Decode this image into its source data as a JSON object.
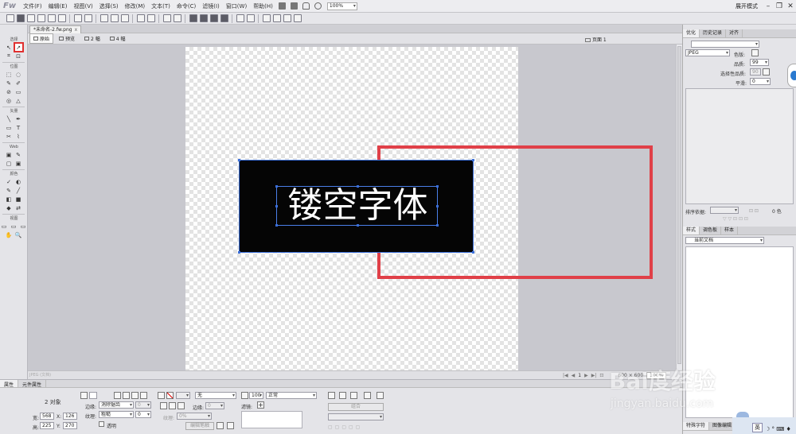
{
  "app": {
    "logo": "Fw",
    "expand_mode": "展开模式"
  },
  "menu": [
    "文件(F)",
    "编辑(E)",
    "视图(V)",
    "选择(S)",
    "修改(M)",
    "文本(T)",
    "命令(C)",
    "滤镜(I)",
    "窗口(W)",
    "帮助(H)"
  ],
  "menu_zoom": "100%",
  "window_controls": [
    "–",
    "❐",
    "✕"
  ],
  "document": {
    "tab_title": "*未命名-2.fw.png",
    "tab_close": "x",
    "views": [
      "原始",
      "预览",
      "2 幅",
      "4 幅"
    ],
    "page_label": "页面 1",
    "text_content": "镂空字体"
  },
  "tools": {
    "sections": [
      "选择",
      "位图",
      "矢量",
      "Web",
      "颜色",
      "视图"
    ],
    "select_rows": [
      [
        "↖",
        "↗"
      ],
      [
        "⌗",
        "⊡"
      ]
    ],
    "bitmap_rows": [
      [
        "⬚",
        "◌"
      ],
      [
        "✎",
        "✐"
      ],
      [
        "⊘",
        "▭"
      ],
      [
        "◎",
        "△"
      ]
    ],
    "vector_rows": [
      [
        "╲",
        "✒"
      ],
      [
        "▭",
        "T"
      ],
      [
        "✂",
        "⌇"
      ]
    ],
    "web_rows": [
      [
        "▣",
        "✎"
      ],
      [
        "▢",
        "▣"
      ]
    ],
    "color_rows": [
      [
        "✓",
        "◐"
      ],
      [
        "✎",
        "╱"
      ],
      [
        "◧",
        "■"
      ],
      [
        "◆",
        "⇄"
      ]
    ],
    "view_rows": [
      [
        "▭",
        "▭",
        "▭"
      ],
      [
        "✋",
        "🔍"
      ]
    ]
  },
  "status": {
    "file_format": "JPEG (文档)",
    "nav": [
      "|◀",
      "◀",
      "1",
      "▶",
      "▶|",
      "⊡"
    ],
    "dims": "600 × 600",
    "zoom": "100%"
  },
  "props": {
    "tabs": [
      "属性",
      "元件属性"
    ],
    "object_count": "2 对象",
    "w_label": "宽:",
    "w_value": "568",
    "x_label": "X:",
    "x_value": "126",
    "h_label": "高:",
    "h_value": "225",
    "y_label": "Y:",
    "y_value": "270",
    "edge_label": "边缘:",
    "edge_value": "消除锯齿",
    "edge_num": "0",
    "texture_label": "纹理:",
    "texture_value": "粗糙",
    "texture_num": "0",
    "transparent_label": "透明",
    "stroke_none": "无",
    "stroke_edge_label": "边缘:",
    "stroke_edge_value": "0",
    "stroke_texture_label": "纹理:",
    "stroke_texture_value": "0%",
    "edit_stroke_label": "编辑笔触",
    "opacity_value": "100",
    "blend_value": "正常",
    "filters_label": "滤镜:",
    "filters_add": "+",
    "combine_label": "组合"
  },
  "right_panel": {
    "tabs_top": [
      "优化",
      "历史记录",
      "对齐"
    ],
    "format": "JPEG",
    "color_label": "色版:",
    "quality_label": "品质:",
    "quality_value": "99",
    "selective_label": "选择性品质:",
    "selective_value": "90",
    "smooth_label": "平滑:",
    "smooth_value": "0",
    "sort_label": "排序依据:",
    "colors_count": "0 色",
    "tabs_mid": [
      "样式",
      "调色板",
      "样本"
    ],
    "current_doc": "当前文档",
    "tabs_bottom": [
      "特殊字符",
      "图像编辑"
    ]
  },
  "watermark": {
    "text": "Bai度经验",
    "sub": "jingyan.baidu.com"
  },
  "taskbar": {
    "ime": "英",
    "icons": "☽ ° ⌨ ♦"
  }
}
